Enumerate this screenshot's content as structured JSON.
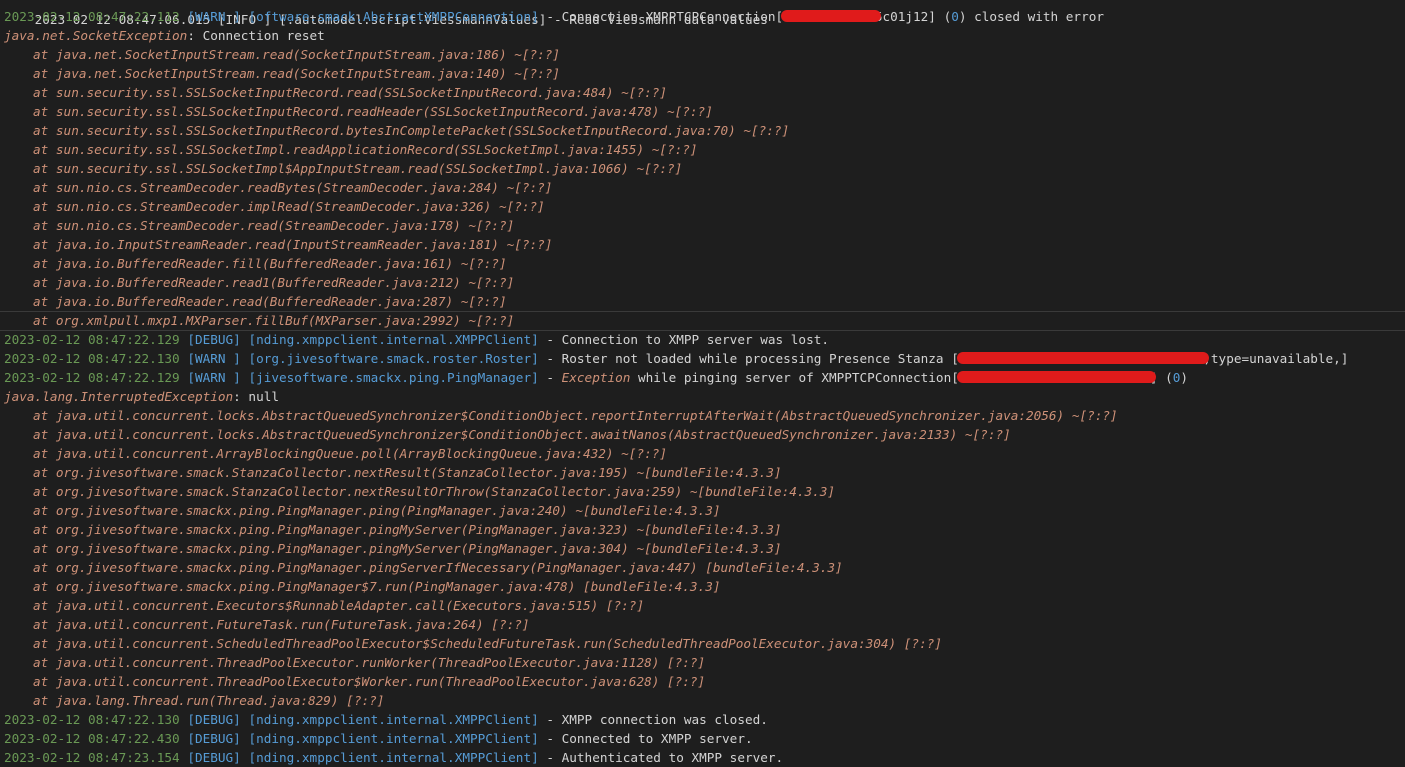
{
  "top_partial": "2023-02-12 08:47:06.015 [INFO ] [.automodel.script.ViessmannValues] - Read Viessmann data values",
  "lines": [
    {
      "kind": "log",
      "ts": "2023-02-12 08:47:22.112",
      "level": "[WARN ]",
      "logger": "[oftware.smack.AbstractXMPPConnection]",
      "pre": " - Connection XMPPTCPConnection[",
      "redacted": "            ",
      "post": "5c01j12] (",
      "num": "0",
      "post2": ") closed with error"
    },
    {
      "kind": "exc",
      "cls": "java.net.SocketException",
      "text": ": Connection reset"
    },
    {
      "kind": "frame",
      "text": "at java.net.SocketInputStream.read(SocketInputStream.java:186) ~[?:?]"
    },
    {
      "kind": "frame",
      "text": "at java.net.SocketInputStream.read(SocketInputStream.java:140) ~[?:?]"
    },
    {
      "kind": "frame",
      "text": "at sun.security.ssl.SSLSocketInputRecord.read(SSLSocketInputRecord.java:484) ~[?:?]"
    },
    {
      "kind": "frame",
      "text": "at sun.security.ssl.SSLSocketInputRecord.readHeader(SSLSocketInputRecord.java:478) ~[?:?]"
    },
    {
      "kind": "frame",
      "text": "at sun.security.ssl.SSLSocketInputRecord.bytesInCompletePacket(SSLSocketInputRecord.java:70) ~[?:?]"
    },
    {
      "kind": "frame",
      "text": "at sun.security.ssl.SSLSocketImpl.readApplicationRecord(SSLSocketImpl.java:1455) ~[?:?]"
    },
    {
      "kind": "frame",
      "text": "at sun.security.ssl.SSLSocketImpl$AppInputStream.read(SSLSocketImpl.java:1066) ~[?:?]"
    },
    {
      "kind": "frame",
      "text": "at sun.nio.cs.StreamDecoder.readBytes(StreamDecoder.java:284) ~[?:?]"
    },
    {
      "kind": "frame",
      "text": "at sun.nio.cs.StreamDecoder.implRead(StreamDecoder.java:326) ~[?:?]"
    },
    {
      "kind": "frame",
      "text": "at sun.nio.cs.StreamDecoder.read(StreamDecoder.java:178) ~[?:?]"
    },
    {
      "kind": "frame",
      "text": "at java.io.InputStreamReader.read(InputStreamReader.java:181) ~[?:?]"
    },
    {
      "kind": "frame",
      "text": "at java.io.BufferedReader.fill(BufferedReader.java:161) ~[?:?]"
    },
    {
      "kind": "frame",
      "text": "at java.io.BufferedReader.read1(BufferedReader.java:212) ~[?:?]"
    },
    {
      "kind": "frame",
      "text": "at java.io.BufferedReader.read(BufferedReader.java:287) ~[?:?]"
    },
    {
      "kind": "frame",
      "text": "at org.xmlpull.mxp1.MXParser.fillBuf(MXParser.java:2992) ~[?:?]"
    },
    {
      "kind": "log",
      "ts": "2023-02-12 08:47:22.129",
      "level": "[DEBUG]",
      "logger": "[nding.xmppclient.internal.XMPPClient]",
      "pre": " - Connection to XMPP server was lost."
    },
    {
      "kind": "log",
      "ts": "2023-02-12 08:47:22.130",
      "level": "[WARN ]",
      "logger": "[org.jivesoftware.smack.roster.Roster]",
      "pre": " - Roster not loaded while processing Presence Stanza [",
      "redacted": "                                ",
      "post": ",type=unavailable,]"
    },
    {
      "kind": "log2",
      "ts": "2023-02-12 08:47:22.129",
      "level": "[WARN ]",
      "logger": "[jivesoftware.smackx.ping.PingManager]",
      "pre": " - ",
      "kw": "Exception",
      "mid": " while pinging server of XMPPTCPConnection[",
      "redacted": "                         ",
      "post": "] (",
      "num": "0",
      "post2": ")"
    },
    {
      "kind": "exc",
      "cls": "java.lang.InterruptedException",
      "text": ": null"
    },
    {
      "kind": "frame",
      "text": "at java.util.concurrent.locks.AbstractQueuedSynchronizer$ConditionObject.reportInterruptAfterWait(AbstractQueuedSynchronizer.java:2056) ~[?:?]"
    },
    {
      "kind": "frame",
      "text": "at java.util.concurrent.locks.AbstractQueuedSynchronizer$ConditionObject.awaitNanos(AbstractQueuedSynchronizer.java:2133) ~[?:?]"
    },
    {
      "kind": "frame",
      "text": "at java.util.concurrent.ArrayBlockingQueue.poll(ArrayBlockingQueue.java:432) ~[?:?]"
    },
    {
      "kind": "frame",
      "text": "at org.jivesoftware.smack.StanzaCollector.nextResult(StanzaCollector.java:195) ~[bundleFile:4.3.3]"
    },
    {
      "kind": "frame",
      "text": "at org.jivesoftware.smack.StanzaCollector.nextResultOrThrow(StanzaCollector.java:259) ~[bundleFile:4.3.3]"
    },
    {
      "kind": "frame",
      "text": "at org.jivesoftware.smackx.ping.PingManager.ping(PingManager.java:240) ~[bundleFile:4.3.3]"
    },
    {
      "kind": "frame",
      "text": "at org.jivesoftware.smackx.ping.PingManager.pingMyServer(PingManager.java:323) ~[bundleFile:4.3.3]"
    },
    {
      "kind": "frame",
      "text": "at org.jivesoftware.smackx.ping.PingManager.pingMyServer(PingManager.java:304) ~[bundleFile:4.3.3]"
    },
    {
      "kind": "frame",
      "text": "at org.jivesoftware.smackx.ping.PingManager.pingServerIfNecessary(PingManager.java:447) [bundleFile:4.3.3]"
    },
    {
      "kind": "frame",
      "text": "at org.jivesoftware.smackx.ping.PingManager$7.run(PingManager.java:478) [bundleFile:4.3.3]"
    },
    {
      "kind": "frame",
      "text": "at java.util.concurrent.Executors$RunnableAdapter.call(Executors.java:515) [?:?]"
    },
    {
      "kind": "frame",
      "text": "at java.util.concurrent.FutureTask.run(FutureTask.java:264) [?:?]"
    },
    {
      "kind": "frame",
      "text": "at java.util.concurrent.ScheduledThreadPoolExecutor$ScheduledFutureTask.run(ScheduledThreadPoolExecutor.java:304) [?:?]"
    },
    {
      "kind": "frame",
      "text": "at java.util.concurrent.ThreadPoolExecutor.runWorker(ThreadPoolExecutor.java:1128) [?:?]"
    },
    {
      "kind": "frame",
      "text": "at java.util.concurrent.ThreadPoolExecutor$Worker.run(ThreadPoolExecutor.java:628) [?:?]"
    },
    {
      "kind": "frame",
      "text": "at java.lang.Thread.run(Thread.java:829) [?:?]"
    },
    {
      "kind": "log",
      "ts": "2023-02-12 08:47:22.130",
      "level": "[DEBUG]",
      "logger": "[nding.xmppclient.internal.XMPPClient]",
      "pre": " - XMPP connection was closed."
    },
    {
      "kind": "log",
      "ts": "2023-02-12 08:47:22.430",
      "level": "[DEBUG]",
      "logger": "[nding.xmppclient.internal.XMPPClient]",
      "pre": " - Connected to XMPP server."
    },
    {
      "kind": "log",
      "ts": "2023-02-12 08:47:23.154",
      "level": "[DEBUG]",
      "logger": "[nding.xmppclient.internal.XMPPClient]",
      "pre": " - Authenticated to XMPP server."
    }
  ],
  "colors": {
    "background": "#1e1e1e",
    "timestamp": "#6a9955",
    "level": "#569cd6",
    "logger": "#569cd6",
    "message": "#d4d4d4",
    "stack_frame": "#ce9178",
    "redaction": "#e01b1b"
  }
}
